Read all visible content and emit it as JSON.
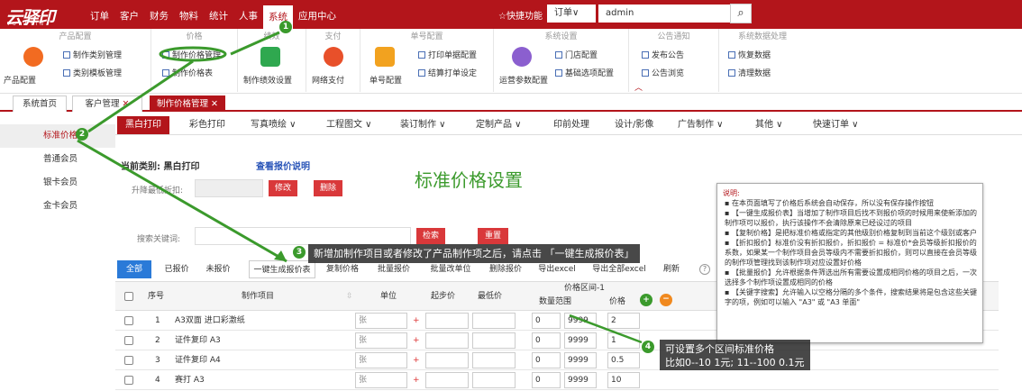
{
  "header": {
    "logo": "云驿印",
    "logo_sub": "YUNEYIN",
    "nav": [
      "订单",
      "客户",
      "财务",
      "物料",
      "统计",
      "人事",
      "系统",
      "应用中心"
    ],
    "active_nav": "系统",
    "quick": "☆快捷功能",
    "order_select": "订单∨",
    "user": "admin"
  },
  "ribbon": {
    "groups": [
      {
        "label": "产品配置",
        "big": "产品配置",
        "items": [
          "制作类别管理",
          "类别模板管理"
        ]
      },
      {
        "label": "价格",
        "items": [
          "制作价格管理",
          "制作价格表"
        ]
      },
      {
        "label": "绩效",
        "big": "制作绩效设置"
      },
      {
        "label": "支付",
        "big": "网络支付"
      },
      {
        "label": "单号配置",
        "big": "单号配置",
        "items": [
          "打印单据配置",
          "结算打单设定"
        ]
      },
      {
        "label": "系统设置",
        "big": "运营参数配置",
        "items": [
          "门店配置",
          "基础选项配置"
        ]
      },
      {
        "label": "公告通知",
        "items": [
          "发布公告",
          "公告浏览"
        ]
      },
      {
        "label": "系统数据处理",
        "items": [
          "恢复数据",
          "清理数据"
        ]
      }
    ]
  },
  "tabs": [
    "系统首页",
    "客户管理",
    "制作价格管理"
  ],
  "sidebar": [
    "标准价格",
    "普通会员",
    "银卡会员",
    "金卡会员"
  ],
  "categories": [
    "黑白打印",
    "彩色打印",
    "写真喷绘 ∨",
    "工程图文 ∨",
    "装订制作 ∨",
    "定制产品 ∨",
    "印前处理",
    "设计/影像",
    "广告制作 ∨",
    "其他 ∨",
    "快速订单 ∨"
  ],
  "current": {
    "label": "当前类别: 黑白打印",
    "link": "查看报价说明",
    "title": "标准价格设置",
    "discount_label": "升降最低折扣:",
    "modify": "修改",
    "delete": "删除",
    "keyword_label": "搜索关键词:",
    "search": "检索",
    "reset": "重置"
  },
  "filter_tabs": [
    "全部",
    "已报价",
    "未报价"
  ],
  "toolbar": [
    "一键生成报价表",
    "复制价格",
    "批量报价",
    "批量改单位",
    "删除报价",
    "导出excel",
    "导出全部excel",
    "刷新"
  ],
  "help_icon": "?",
  "table": {
    "headers": {
      "no": "序号",
      "item": "制作项目",
      "unit": "单位",
      "start": "起步价",
      "min": "最低价",
      "range_group": "价格区间-1",
      "range": "数量范围",
      "price": "价格"
    },
    "rows": [
      {
        "no": "1",
        "item": "A3双面 进口彩激纸",
        "unit": "张",
        "from": "0",
        "to": "9999",
        "price": "2"
      },
      {
        "no": "2",
        "item": "证件复印 A3",
        "unit": "张",
        "from": "0",
        "to": "9999",
        "price": "1"
      },
      {
        "no": "3",
        "item": "证件复印 A4",
        "unit": "张",
        "from": "0",
        "to": "9999",
        "price": "0.5"
      },
      {
        "no": "4",
        "item": "赛打 A3",
        "unit": "张",
        "from": "0",
        "to": "9999",
        "price": "10"
      }
    ]
  },
  "note": {
    "title": "说明:",
    "items": [
      "在本页面填写了价格后系统会自动保存，所以没有保存操作按钮",
      "【一键生成报价表】当增加了制作项目后找不到报价项的时候用来使新添加的制作项可以报价，执行该操作不会清除原来已经设过的项目",
      "【复制价格】是把标准价格或指定的其他级别价格复制到当前这个级别或客户",
      "【折扣报价】标准价没有折扣报价，折扣报价 = 标准价*会员等级折扣报价的系数，如果某一个制作项目会员等级内不需要折扣报价，则可以直接在会员等级的制作项管理找到该制作项对应设置好价格",
      "【批量报价】允许根据条件筛选出所有需要设置成相同价格的项目之后，一次选择多个制作项设置成相同的价格",
      "【关键字搜索】允许输入以空格分隔的多个条件，搜索结果将是包含这些关键字的项，例如可以输入 \"A3\" 或 \"A3 单面\""
    ]
  },
  "callouts": {
    "c3": "新增加制作项目或者修改了产品制作项之后，请点击 「一键生成报价表」",
    "c4a": "可设置多个区间标准价格",
    "c4b": "比如0--10  1元; 11--100  0.1元"
  },
  "badges": [
    "1",
    "2",
    "3",
    "4"
  ],
  "colors": {
    "brand": "#b3151b",
    "green": "#3b9a2c"
  }
}
